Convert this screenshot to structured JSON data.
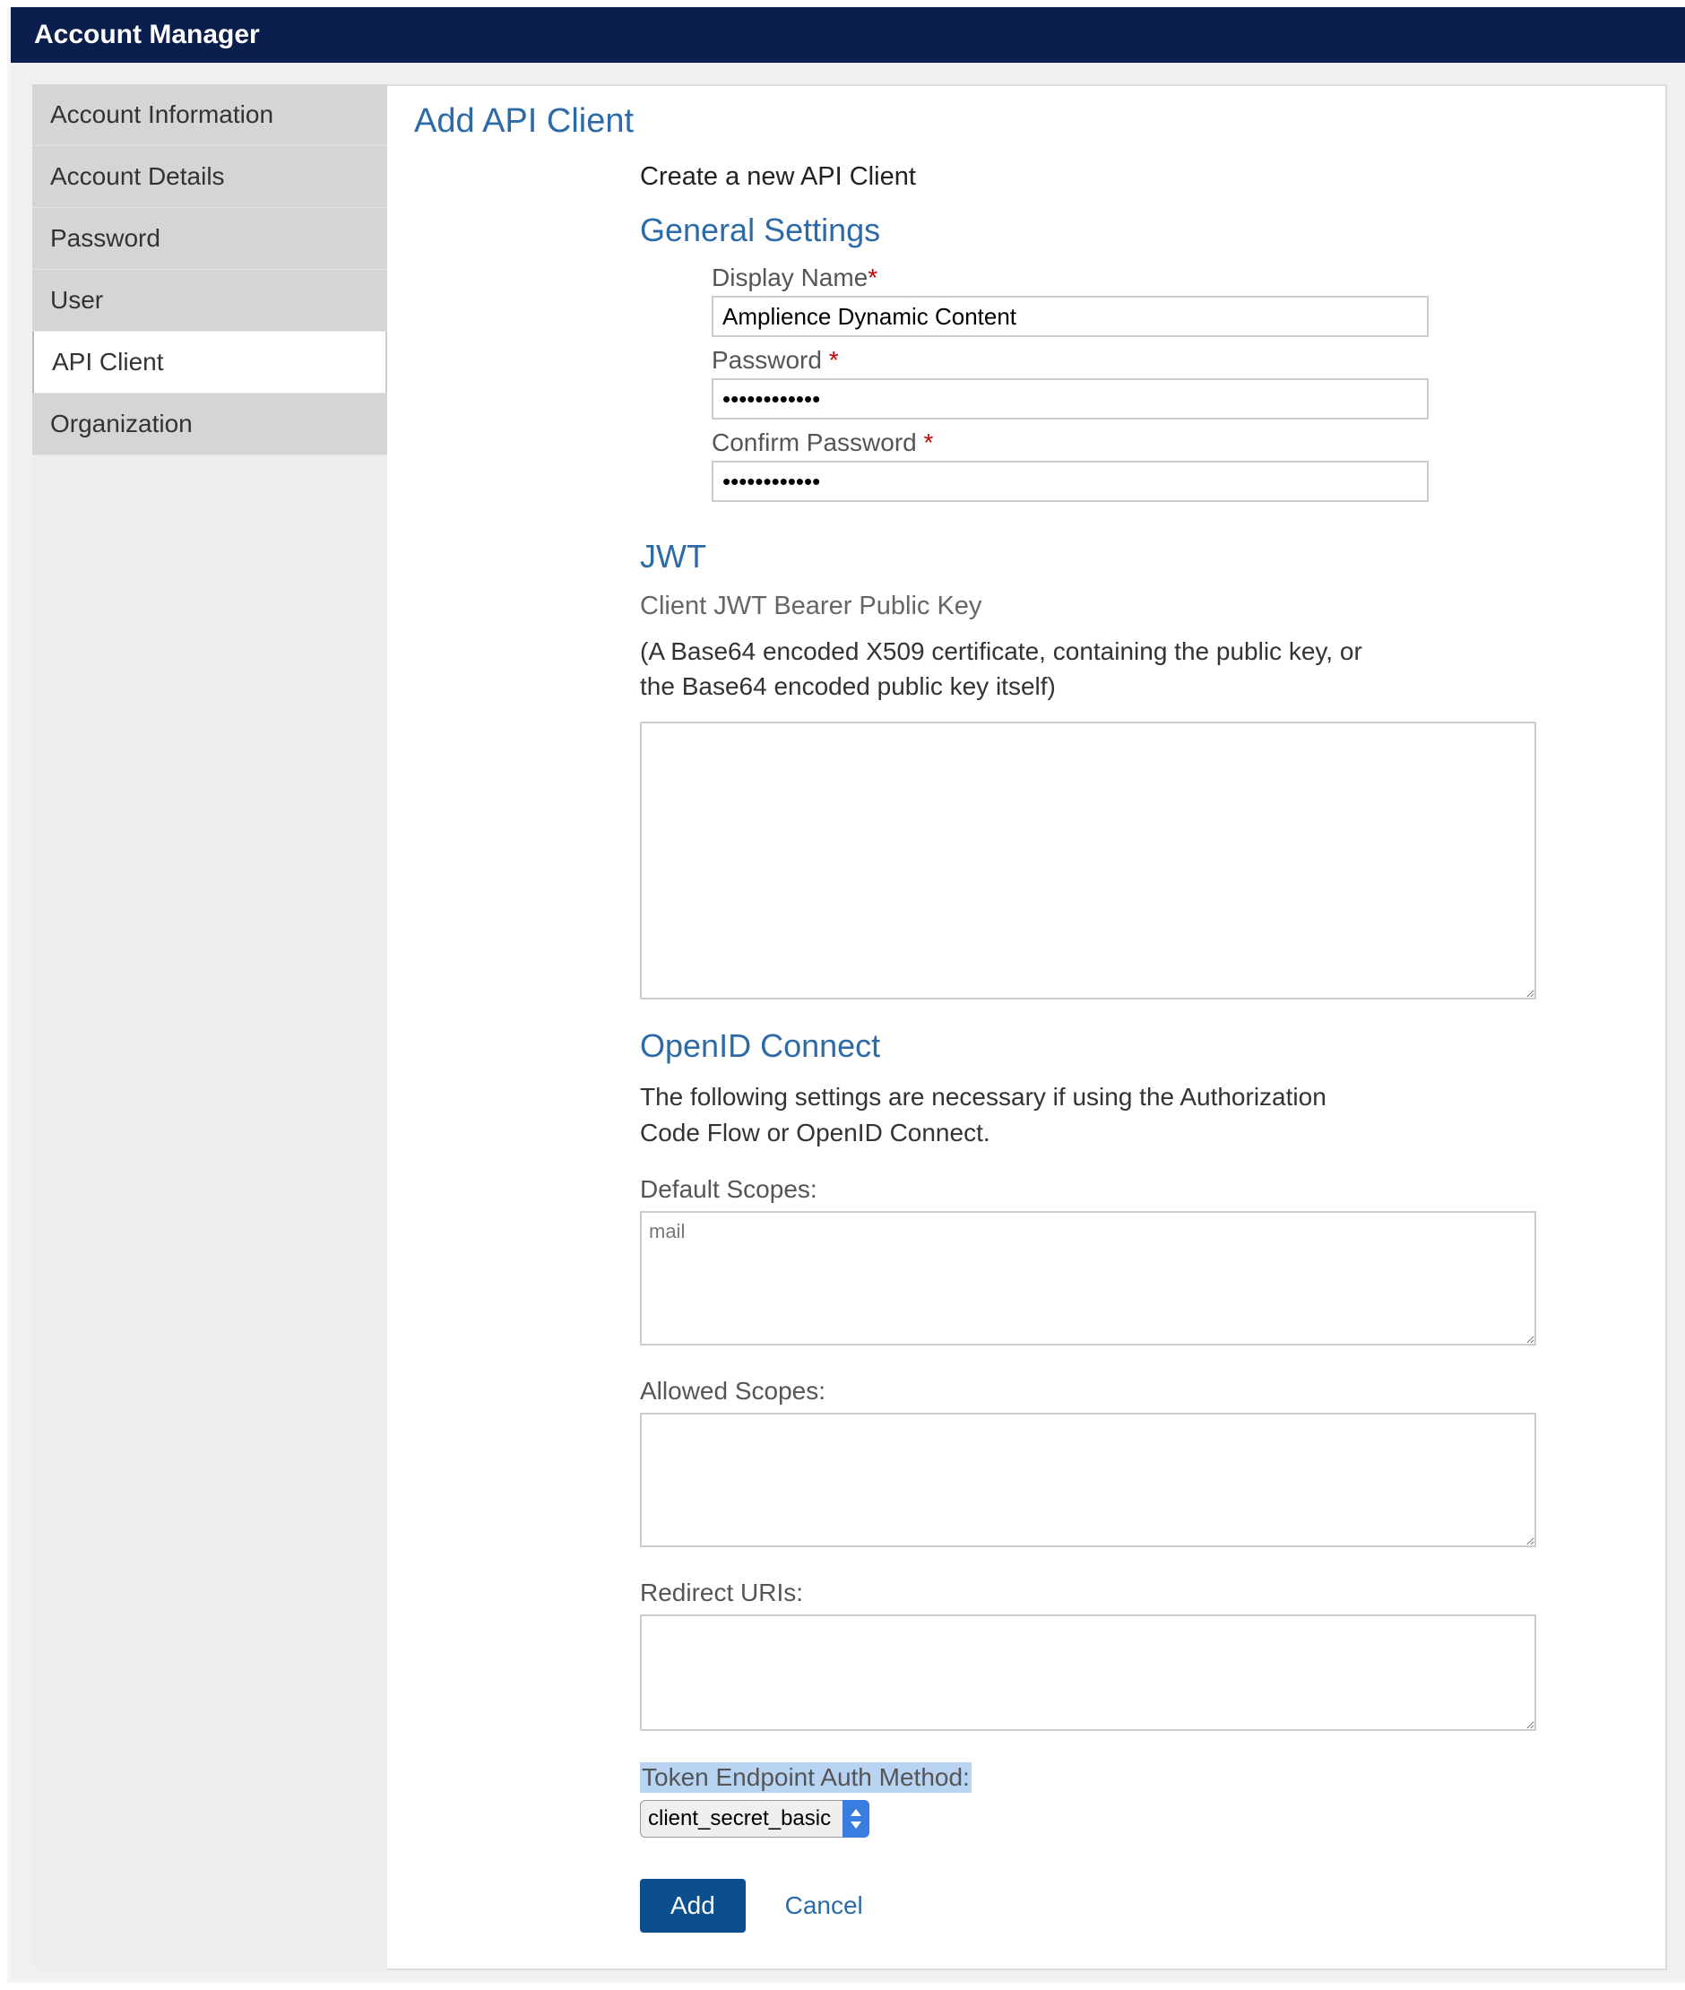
{
  "header": {
    "title": "Account Manager"
  },
  "sidebar": {
    "items": [
      {
        "label": "Account Information"
      },
      {
        "label": "Account Details"
      },
      {
        "label": "Password"
      },
      {
        "label": "User"
      },
      {
        "label": "API Client",
        "active": true
      },
      {
        "label": "Organization"
      }
    ]
  },
  "page": {
    "title": "Add API Client",
    "subtitle": "Create a new API Client",
    "general": {
      "title": "General Settings",
      "display_name_label": "Display Name",
      "display_name_value": "Amplience Dynamic Content",
      "password_label": "Password ",
      "password_value": "••••••••••••",
      "confirm_password_label": "Confirm Password ",
      "confirm_password_value": "••••••••••••"
    },
    "jwt": {
      "title": "JWT",
      "subtitle": "Client JWT Bearer Public Key",
      "help": "(A Base64 encoded X509 certificate, containing the public key, or the Base64 encoded public key itself)",
      "value": ""
    },
    "oidc": {
      "title": "OpenID Connect",
      "help": "The following settings are necessary if using the Authorization Code Flow or OpenID Connect.",
      "default_scopes_label": "Default Scopes:",
      "default_scopes_value": "mail",
      "allowed_scopes_label": "Allowed Scopes:",
      "allowed_scopes_value": "",
      "redirect_uris_label": "Redirect URIs:",
      "redirect_uris_value": "",
      "token_method_label": "Token Endpoint Auth Method:",
      "token_method_value": "client_secret_basic"
    },
    "actions": {
      "add": "Add",
      "cancel": "Cancel"
    }
  }
}
